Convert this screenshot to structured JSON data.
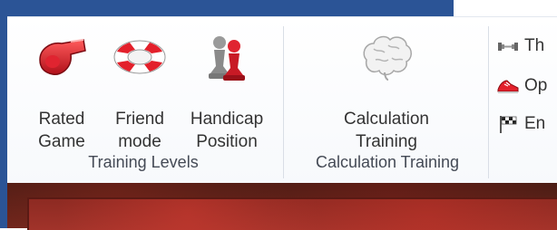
{
  "ribbon": {
    "groups": [
      {
        "label": "Training Levels",
        "buttons": [
          {
            "label": "Rated\nGame",
            "icon": "whistle-icon"
          },
          {
            "label": "Friend\nmode",
            "icon": "lifebuoy-icon"
          },
          {
            "label": "Handicap\nPosition",
            "icon": "pawns-icon"
          }
        ]
      },
      {
        "label": "Calculation Training",
        "buttons": [
          {
            "label": "Calculation\nTraining",
            "icon": "brain-icon"
          }
        ]
      }
    ],
    "small_buttons": [
      {
        "label": "Th",
        "icon": "dumbbell-icon"
      },
      {
        "label": "Op",
        "icon": "running-shoe-icon"
      },
      {
        "label": "En",
        "icon": "chequered-flag-icon"
      }
    ]
  },
  "colors": {
    "title_bar": "#2b5496",
    "ribbon_bg": "#ffffff",
    "board": "#8d2a22"
  }
}
